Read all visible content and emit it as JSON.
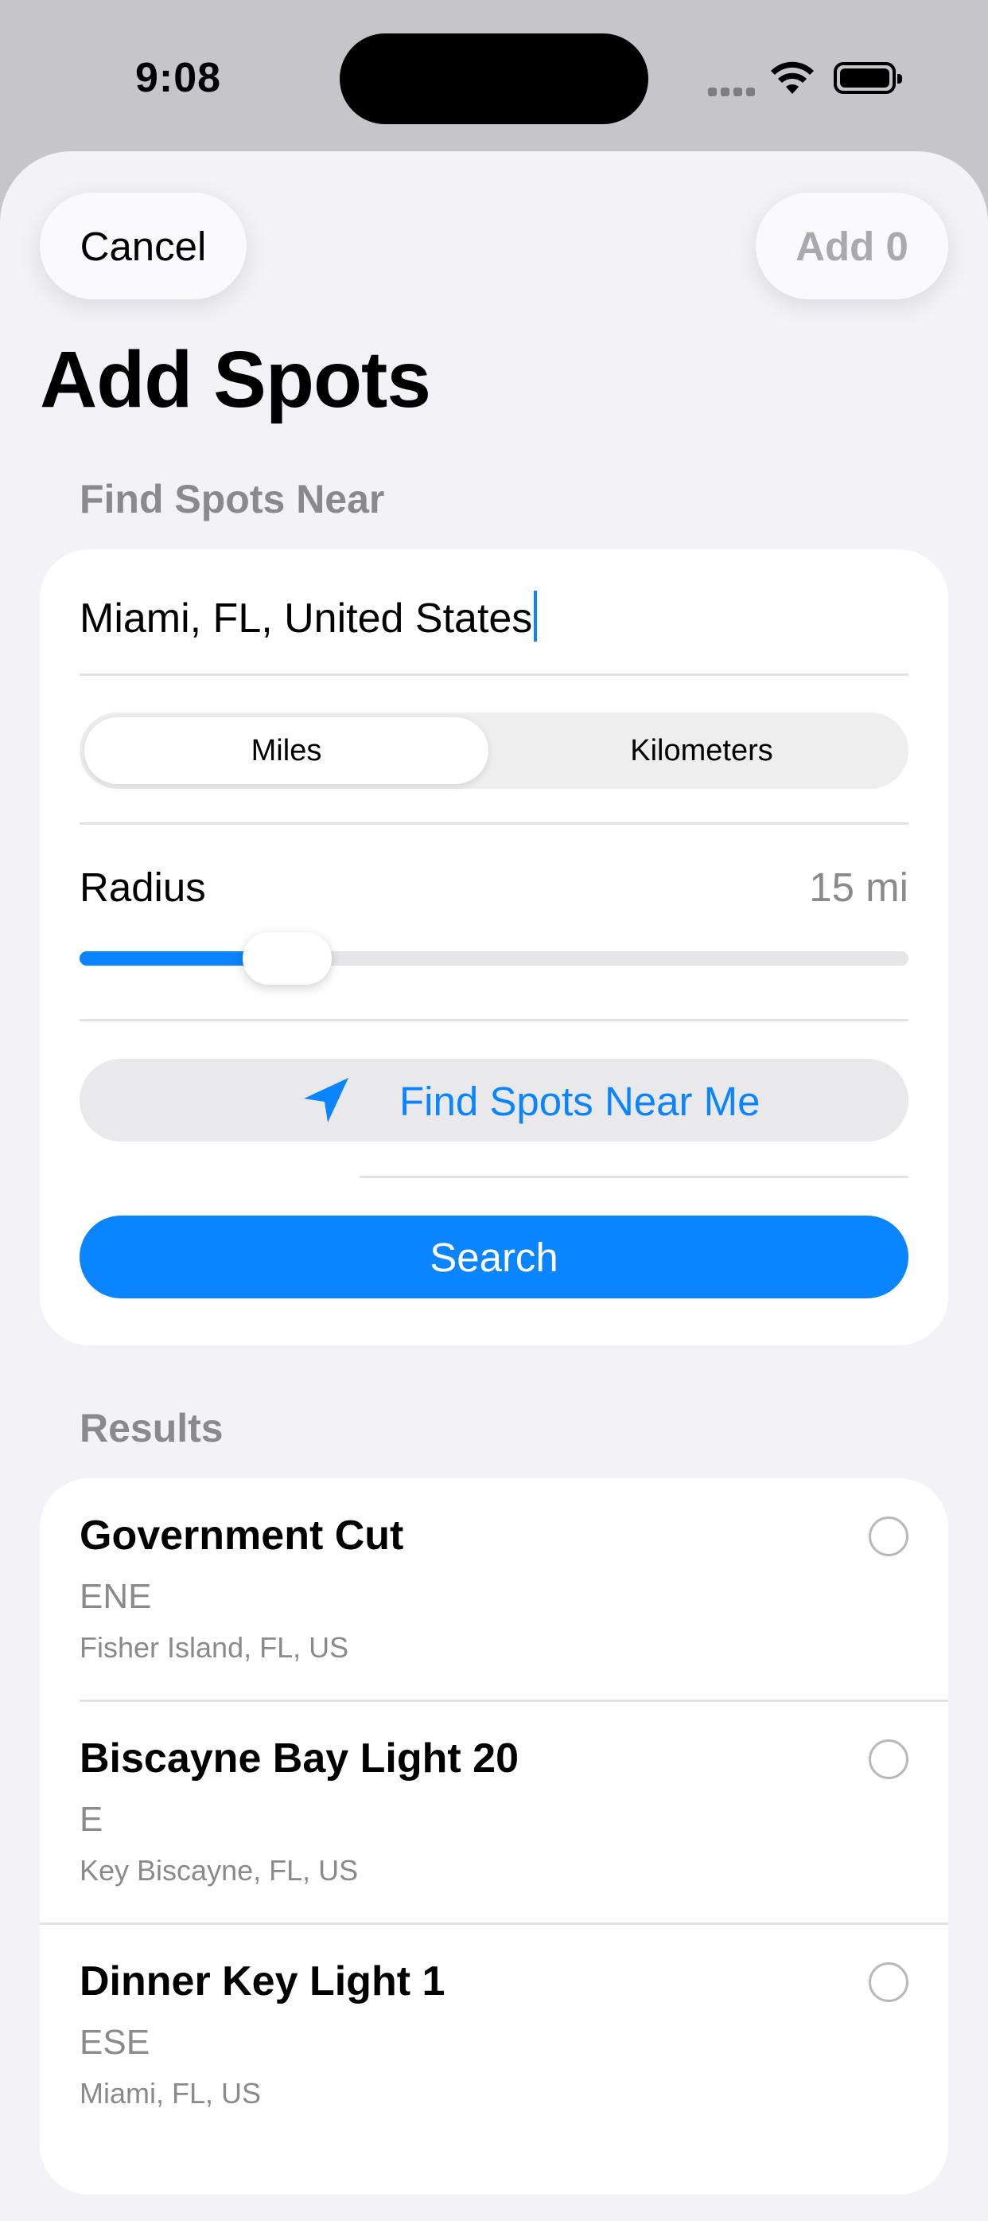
{
  "status_bar": {
    "time": "9:08"
  },
  "header": {
    "cancel_label": "Cancel",
    "add_label": "Add 0",
    "title": "Add Spots"
  },
  "search": {
    "section_title": "Find Spots Near",
    "location_value": "Miami, FL, United States",
    "units": {
      "options": [
        "Miles",
        "Kilometers"
      ],
      "selected": "Miles"
    },
    "radius_label": "Radius",
    "radius_value": "15 mi",
    "radius_slider_fraction": 0.25,
    "near_me_label": "Find Spots Near Me",
    "search_label": "Search"
  },
  "results": {
    "section_title": "Results",
    "items": [
      {
        "name": "Government Cut",
        "direction": "ENE",
        "location": "Fisher Island, FL, US",
        "selected": false
      },
      {
        "name": "Biscayne Bay Light 20",
        "direction": "E",
        "location": "Key Biscayne, FL, US",
        "selected": false
      },
      {
        "name": "Dinner Key Light 1",
        "direction": "ESE",
        "location": "Miami, FL, US",
        "selected": false
      }
    ]
  },
  "colors": {
    "accent": "#0a84ff",
    "background": "#f2f2f7",
    "secondary_text": "#8a8a8e"
  },
  "icons": [
    "wifi-icon",
    "battery-icon",
    "location-arrow-icon",
    "radio-empty-icon"
  ]
}
